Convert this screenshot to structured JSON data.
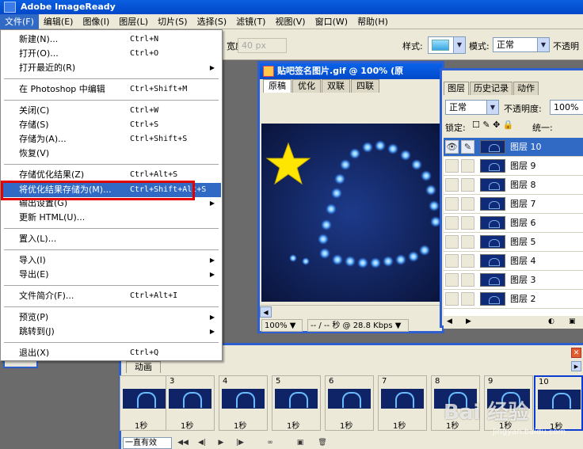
{
  "app": {
    "title": "Adobe ImageReady"
  },
  "menubar": [
    {
      "label": "文件(F)"
    },
    {
      "label": "编辑(E)"
    },
    {
      "label": "图像(I)"
    },
    {
      "label": "图层(L)"
    },
    {
      "label": "切片(S)"
    },
    {
      "label": "选择(S)"
    },
    {
      "label": "滤镜(T)"
    },
    {
      "label": "视图(V)"
    },
    {
      "label": "窗口(W)"
    },
    {
      "label": "帮助(H)"
    }
  ],
  "options": {
    "width_label": "宽度:",
    "width_value": "40 px",
    "style_label": "样式:",
    "mode_label": "模式:",
    "mode_value": "正常",
    "opacity_label": "不透明"
  },
  "file_menu": {
    "items": [
      {
        "label": "新建(N)...",
        "shortcut": "Ctrl+N"
      },
      {
        "label": "打开(O)...",
        "shortcut": "Ctrl+O"
      },
      {
        "label": "打开最近的(R)",
        "shortcut": "",
        "submenu": "▶"
      },
      {
        "label": "在 Photoshop 中编辑",
        "shortcut": "Ctrl+Shift+M"
      },
      {
        "label": "关闭(C)",
        "shortcut": "Ctrl+W"
      },
      {
        "label": "存储(S)",
        "shortcut": "Ctrl+S"
      },
      {
        "label": "存储为(A)...",
        "shortcut": "Ctrl+Shift+S"
      },
      {
        "label": "恢复(V)",
        "shortcut": ""
      },
      {
        "label": "存储优化结果(Z)",
        "shortcut": "Ctrl+Alt+S"
      },
      {
        "label": "将优化结果存储为(M)...",
        "shortcut": "Ctrl+Shift+Alt+S"
      },
      {
        "label": "输出设置(G)",
        "shortcut": "",
        "submenu": "▶"
      },
      {
        "label": "更新 HTML(U)...",
        "shortcut": ""
      },
      {
        "label": "置入(L)...",
        "shortcut": ""
      },
      {
        "label": "导入(I)",
        "shortcut": "",
        "submenu": "▶"
      },
      {
        "label": "导出(E)",
        "shortcut": "",
        "submenu": "▶"
      },
      {
        "label": "文件简介(F)...",
        "shortcut": "Ctrl+Alt+I"
      },
      {
        "label": "预览(P)",
        "shortcut": "",
        "submenu": "▶"
      },
      {
        "label": "跳转到(J)",
        "shortcut": "",
        "submenu": "▶"
      },
      {
        "label": "退出(X)",
        "shortcut": "Ctrl+Q"
      }
    ]
  },
  "document": {
    "title": "贴吧签名图片.gif @ 100% (原",
    "tabs": [
      "原稿",
      "优化",
      "双联",
      "四联"
    ],
    "zoom": "100%",
    "status": "-- / -- 秒 @ 28.8 Kbps"
  },
  "layers_panel": {
    "tabs": [
      "图层",
      "历史记录",
      "动作"
    ],
    "blend_mode": "正常",
    "opacity_label": "不透明度:",
    "opacity_value": "100%",
    "lock_label": "锁定:",
    "unify_label": "统一:",
    "layers": [
      {
        "name": "图层 10"
      },
      {
        "name": "图层 9"
      },
      {
        "name": "图层 8"
      },
      {
        "name": "图层 7"
      },
      {
        "name": "图层 6"
      },
      {
        "name": "图层 5"
      },
      {
        "name": "图层 4"
      },
      {
        "name": "图层 3"
      },
      {
        "name": "图层 2"
      }
    ]
  },
  "animation_panel": {
    "tab": "动画",
    "frames": [
      {
        "num": "",
        "delay": "1秒"
      },
      {
        "num": "3",
        "delay": "1秒"
      },
      {
        "num": "4",
        "delay": "1秒"
      },
      {
        "num": "5",
        "delay": "1秒"
      },
      {
        "num": "6",
        "delay": "1秒"
      },
      {
        "num": "7",
        "delay": "1秒"
      },
      {
        "num": "8",
        "delay": "1秒"
      },
      {
        "num": "9",
        "delay": "1秒"
      },
      {
        "num": "10",
        "delay": "1秒"
      }
    ],
    "loop": "一直有效"
  },
  "watermark": {
    "text": "Bai 经验",
    "url": "jingyan.baidu.com"
  },
  "colors": {
    "accent": "#316ac5",
    "titlebar": "#0a5fe0",
    "highlight_box": "#e30000"
  }
}
